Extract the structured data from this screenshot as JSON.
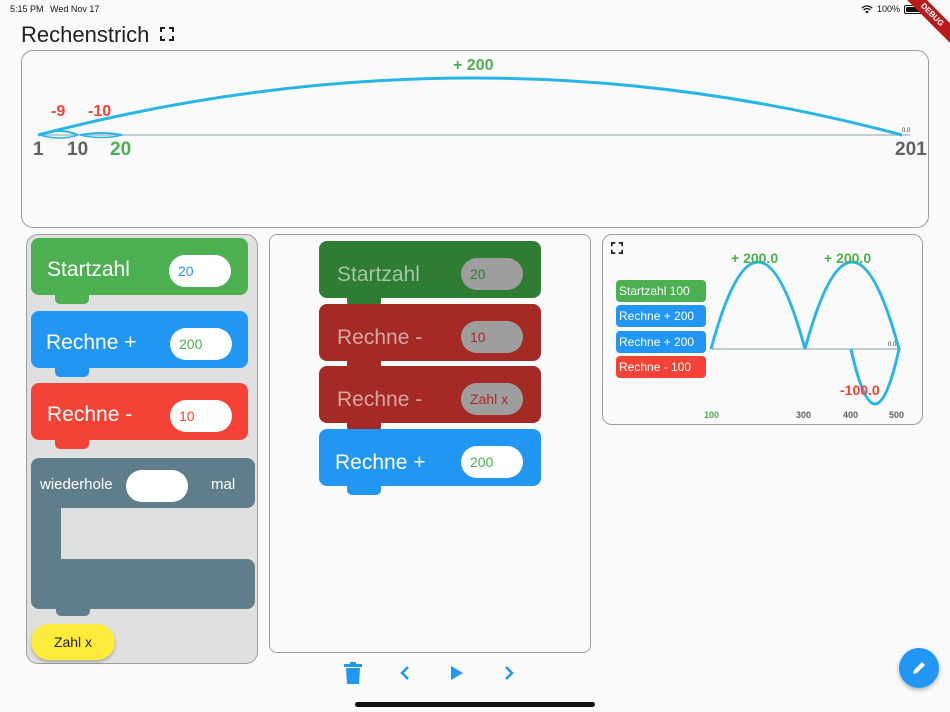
{
  "status": {
    "time": "5:15 PM",
    "date": "Wed Nov 17",
    "battery": "100%",
    "debug": "DEBUG"
  },
  "header": {
    "title": "Rechenstrich",
    "expand_icon": "fullscreen-icon"
  },
  "number_line": {
    "ticks": [
      {
        "label": "1",
        "color": "#616161"
      },
      {
        "label": "10",
        "color": "#616161"
      },
      {
        "label": "20",
        "color": "#4caf50"
      },
      {
        "label": "201",
        "color": "#616161"
      }
    ],
    "arcs": [
      {
        "label": "-9",
        "color": "#f44336"
      },
      {
        "label": "-10",
        "color": "#f44336"
      },
      {
        "label": "+ 200",
        "color": "#4caf50"
      }
    ],
    "tiny_label": "0.0",
    "arc_color": "#29b6e6"
  },
  "palette": {
    "startzahl": {
      "label": "Startzahl",
      "value": "20"
    },
    "add": {
      "label": "Rechne +",
      "value": "200"
    },
    "sub": {
      "label": "Rechne -",
      "value": "10"
    },
    "repeat": {
      "label_left": "wiederhole",
      "label_right": "mal",
      "value": ""
    },
    "variable": {
      "label": "Zahl x"
    }
  },
  "program": {
    "blocks": [
      {
        "label": "Startzahl",
        "value": "20"
      },
      {
        "label": "Rechne -",
        "value": "10"
      },
      {
        "label": "Rechne -",
        "value": "Zahl x"
      },
      {
        "label": "Rechne +",
        "value": "200"
      }
    ]
  },
  "preview": {
    "legend": [
      {
        "label": "Startzahl 100",
        "color": "#4caf50"
      },
      {
        "label": "Rechne + 200",
        "color": "#2196f3"
      },
      {
        "label": "Rechne + 200",
        "color": "#2196f3"
      },
      {
        "label": "Rechne - 100",
        "color": "#f44336"
      }
    ],
    "arc_labels": [
      "+ 200.0",
      "+ 200.0",
      "-100.0"
    ],
    "axis": [
      "100",
      "300",
      "400",
      "500"
    ],
    "tiny_label": "0.0"
  },
  "controls": {
    "trash": "trash-icon",
    "prev": "chevron-left-icon",
    "play": "play-icon",
    "next": "chevron-right-icon"
  },
  "colors": {
    "green": "#4caf50",
    "blue": "#2196f3",
    "red": "#f44336",
    "slate": "#607d8b",
    "dark_green": "#2e7d32",
    "dark_red": "#a52a25",
    "yellow": "#ffeb3b",
    "accent": "#2196f3"
  }
}
